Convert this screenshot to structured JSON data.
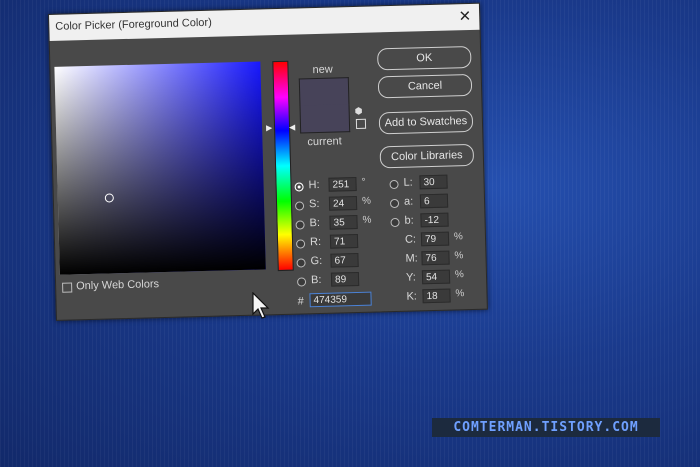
{
  "window": {
    "title": "Color Picker (Foreground Color)",
    "close_glyph": "✕"
  },
  "preview": {
    "new_label": "new",
    "current_label": "current",
    "color": "#474359"
  },
  "buttons": {
    "ok": "OK",
    "cancel": "Cancel",
    "add_to_swatches": "Add to Swatches",
    "color_libraries": "Color Libraries"
  },
  "hsb": {
    "h": {
      "label": "H:",
      "value": "251",
      "unit": "°"
    },
    "s": {
      "label": "S:",
      "value": "24",
      "unit": "%"
    },
    "b": {
      "label": "B:",
      "value": "35",
      "unit": "%"
    }
  },
  "rgb": {
    "r": {
      "label": "R:",
      "value": "71"
    },
    "g": {
      "label": "G:",
      "value": "67"
    },
    "b": {
      "label": "B:",
      "value": "89"
    }
  },
  "lab": {
    "l": {
      "label": "L:",
      "value": "30"
    },
    "a": {
      "label": "a:",
      "value": "6"
    },
    "b": {
      "label": "b:",
      "value": "-12"
    }
  },
  "cmyk": {
    "c": {
      "label": "C:",
      "value": "79",
      "unit": "%"
    },
    "m": {
      "label": "M:",
      "value": "76",
      "unit": "%"
    },
    "y": {
      "label": "Y:",
      "value": "54",
      "unit": "%"
    },
    "k": {
      "label": "K:",
      "value": "18",
      "unit": "%"
    }
  },
  "hex": {
    "label": "#",
    "value": "474359"
  },
  "only_web_colors": {
    "label": "Only Web Colors",
    "checked": false
  },
  "icons": [
    "close-icon",
    "cube-icon",
    "websafe-icon",
    "mouse-cursor-icon"
  ],
  "watermark": "COMTERMAN.TISTORY.COM"
}
